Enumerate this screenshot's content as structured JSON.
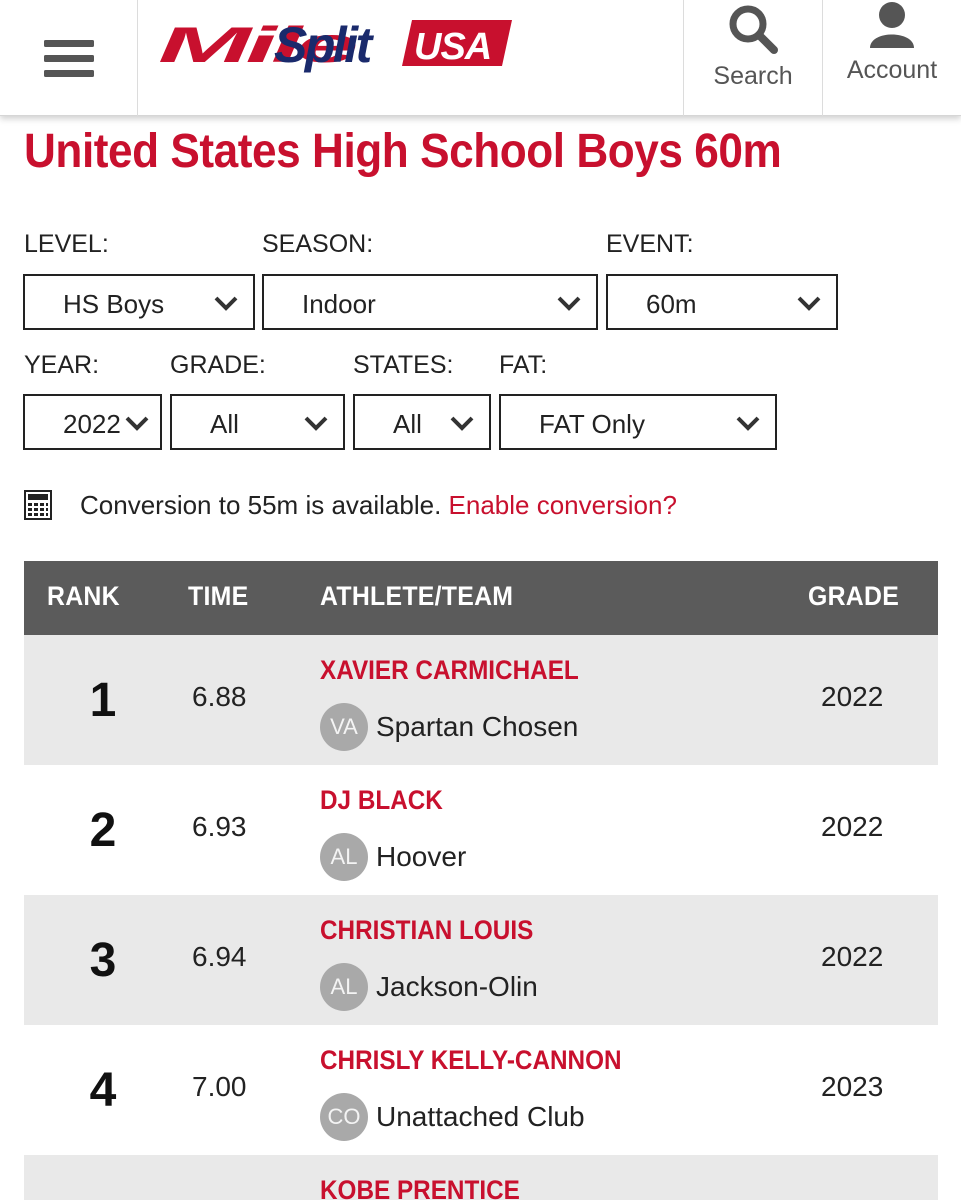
{
  "header": {
    "logo_text": "MileSplit",
    "logo_badge": "USA",
    "search_label": "Search",
    "account_label": "Account",
    "brand_red": "#c8102e",
    "brand_navy": "#1a2a6c"
  },
  "page": {
    "title": "United States High School Boys 60m"
  },
  "filters": {
    "level": {
      "label": "LEVEL:",
      "value": "HS Boys"
    },
    "season": {
      "label": "SEASON:",
      "value": "Indoor"
    },
    "event": {
      "label": "EVENT:",
      "value": "60m"
    },
    "year": {
      "label": "YEAR:",
      "value": "2022"
    },
    "grade": {
      "label": "GRADE:",
      "value": "All"
    },
    "states": {
      "label": "STATES:",
      "value": "All"
    },
    "fat": {
      "label": "FAT:",
      "value": "FAT Only"
    }
  },
  "conversion": {
    "icon": "calculator-icon",
    "text": "Conversion to 55m is available.",
    "link": "Enable conversion?"
  },
  "table": {
    "headers": {
      "rank": "RANK",
      "time": "TIME",
      "athlete": "ATHLETE/TEAM",
      "grade": "GRADE"
    },
    "rows": [
      {
        "rank": "1",
        "time": "6.88",
        "athlete": "XAVIER CARMICHAEL",
        "state": "VA",
        "team": "Spartan Chosen",
        "grade": "2022"
      },
      {
        "rank": "2",
        "time": "6.93",
        "athlete": "DJ BLACK",
        "state": "AL",
        "team": "Hoover",
        "grade": "2022"
      },
      {
        "rank": "3",
        "time": "6.94",
        "athlete": "CHRISTIAN LOUIS",
        "state": "AL",
        "team": "Jackson-Olin",
        "grade": "2022"
      },
      {
        "rank": "4",
        "time": "7.00",
        "athlete": "CHRISLY KELLY-CANNON",
        "state": "CO",
        "team": "Unattached Club",
        "grade": "2023"
      },
      {
        "rank": "",
        "time": "",
        "athlete": "KOBE PRENTICE",
        "state": "",
        "team": "",
        "grade": ""
      }
    ]
  }
}
